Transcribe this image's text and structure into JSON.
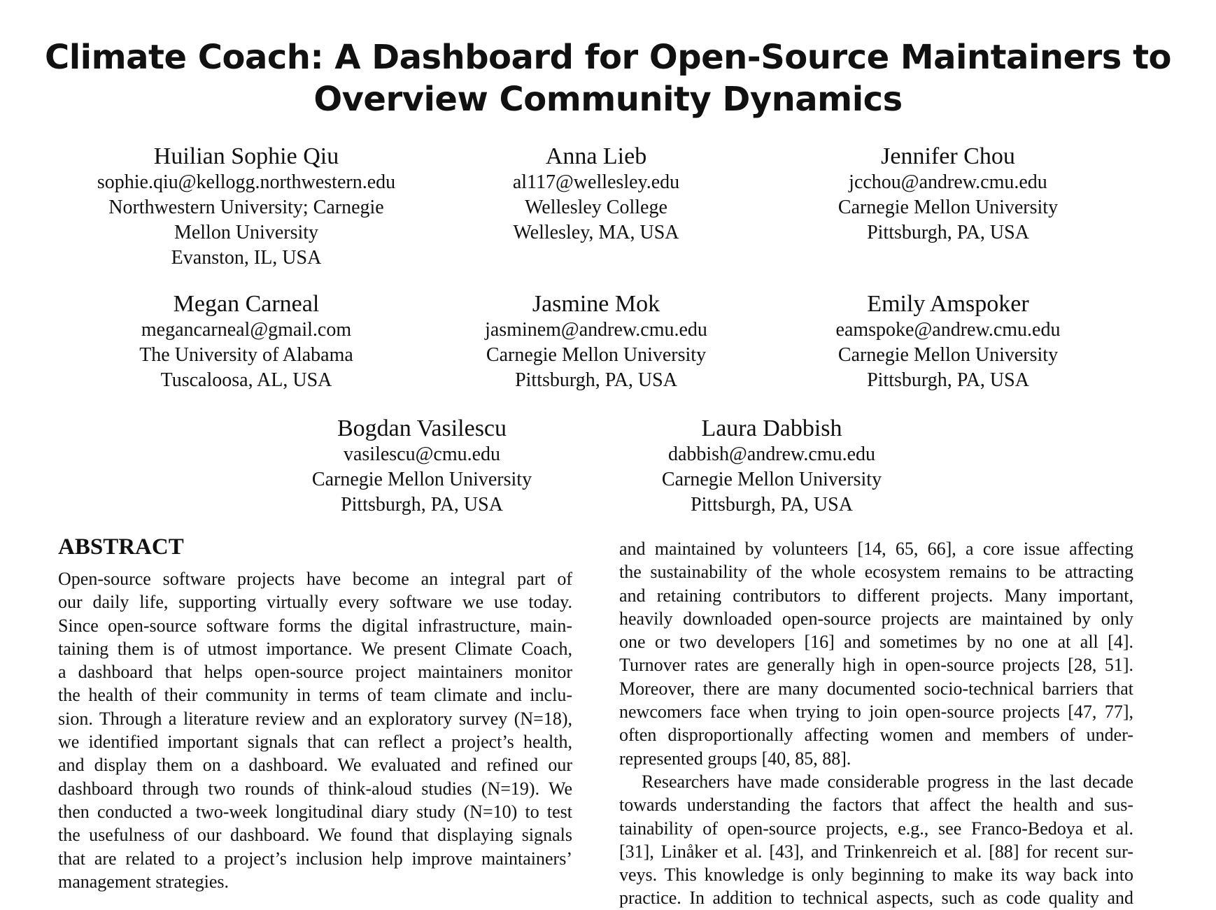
{
  "title": {
    "line1": "Climate Coach: A Dashboard for Open-Source Maintainers to",
    "line2": "Overview Community Dynamics"
  },
  "authors": [
    {
      "name": "Huilian Sophie Qiu",
      "lines": [
        "sophie.qiu@kellogg.northwestern.edu",
        "Northwestern University; Carnegie",
        "Mellon University",
        "Evanston, IL, USA"
      ]
    },
    {
      "name": "Anna Lieb",
      "lines": [
        "al117@wellesley.edu",
        "Wellesley College",
        "Wellesley, MA, USA"
      ]
    },
    {
      "name": "Jennifer Chou",
      "lines": [
        "jcchou@andrew.cmu.edu",
        "Carnegie Mellon University",
        "Pittsburgh, PA, USA"
      ]
    },
    {
      "name": "Megan Carneal",
      "lines": [
        "megancarneal@gmail.com",
        "The University of Alabama",
        "Tuscaloosa, AL, USA"
      ]
    },
    {
      "name": "Jasmine Mok",
      "lines": [
        "jasminem@andrew.cmu.edu",
        "Carnegie Mellon University",
        "Pittsburgh, PA, USA"
      ]
    },
    {
      "name": "Emily Amspoker",
      "lines": [
        "eamspoke@andrew.cmu.edu",
        "Carnegie Mellon University",
        "Pittsburgh, PA, USA"
      ]
    },
    {
      "name": "Bogdan Vasilescu",
      "lines": [
        "vasilescu@cmu.edu",
        "Carnegie Mellon University",
        "Pittsburgh, PA, USA"
      ]
    },
    {
      "name": "Laura Dabbish",
      "lines": [
        "dabbish@andrew.cmu.edu",
        "Carnegie Mellon University",
        "Pittsburgh, PA, USA"
      ]
    }
  ],
  "abstract": {
    "heading": "ABSTRACT",
    "lines": [
      "Open-source software projects have become an integral part of",
      "our daily life, supporting virtually every software we use today.",
      "Since open-source software forms the digital infrastructure, main-",
      "taining them is of utmost importance. We present Climate Coach,",
      "a dashboard that helps open-source project maintainers monitor",
      "the health of their community in terms of team climate and inclu-",
      "sion. Through a literature review and an exploratory survey (N=18),",
      "we identified important signals that can reflect a project’s health,",
      "and display them on a dashboard. We evaluated and refined our",
      "dashboard through two rounds of think-aloud studies (N=19). We",
      "then conducted a two-week longitudinal diary study (N=10) to test",
      "the usefulness of our dashboard. We found that displaying signals",
      "that are related to a project’s inclusion help improve maintainers’",
      "management strategies."
    ]
  },
  "right_column": {
    "para1": [
      "and maintained by volunteers [14, 65, 66], a core issue affecting",
      "the sustainability of the whole ecosystem remains to be attracting",
      "and retaining contributors to different projects. Many important,",
      "heavily downloaded open-source projects are maintained by only",
      "one or two developers [16] and sometimes by no one at all [4].",
      "Turnover rates are generally high in open-source projects [28, 51].",
      "Moreover, there are many documented socio-technical barriers that",
      "newcomers face when trying to join open-source projects [47, 77],",
      "often disproportionally affecting women and members of under-",
      "represented groups [40, 85, 88]."
    ],
    "para2": [
      "Researchers have made considerable progress in the last decade",
      "towards understanding the factors that affect the health and sus-",
      "tainability of open-source projects, e.g., see Franco-Bedoya et al.",
      "[31], Linåker et al. [43], and Trinkenreich et al. [88] for recent sur-",
      "veys. This knowledge is only beginning to make its way back into",
      "practice. In addition to technical aspects, such as code quality and"
    ]
  }
}
